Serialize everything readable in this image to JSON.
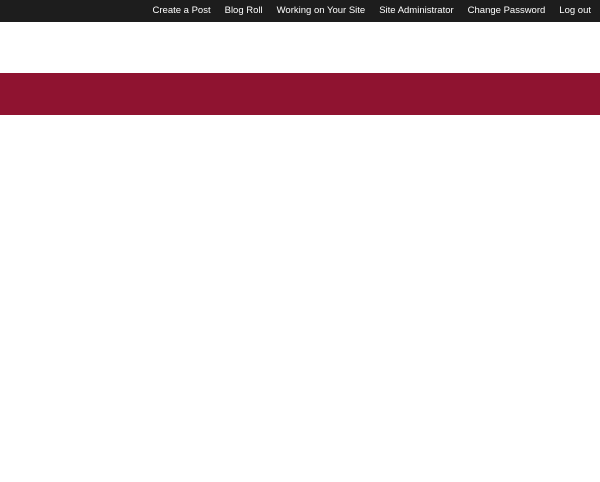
{
  "top_nav": {
    "items": [
      {
        "label": "Create a Post"
      },
      {
        "label": "Blog Roll"
      },
      {
        "label": "Working on Your Site"
      },
      {
        "label": "Site Administrator"
      },
      {
        "label": "Change Password"
      },
      {
        "label": "Log out"
      }
    ]
  },
  "colors": {
    "top_bar": "#1d1d1d",
    "accent_band": "#8f1330",
    "background": "#ffffff"
  }
}
